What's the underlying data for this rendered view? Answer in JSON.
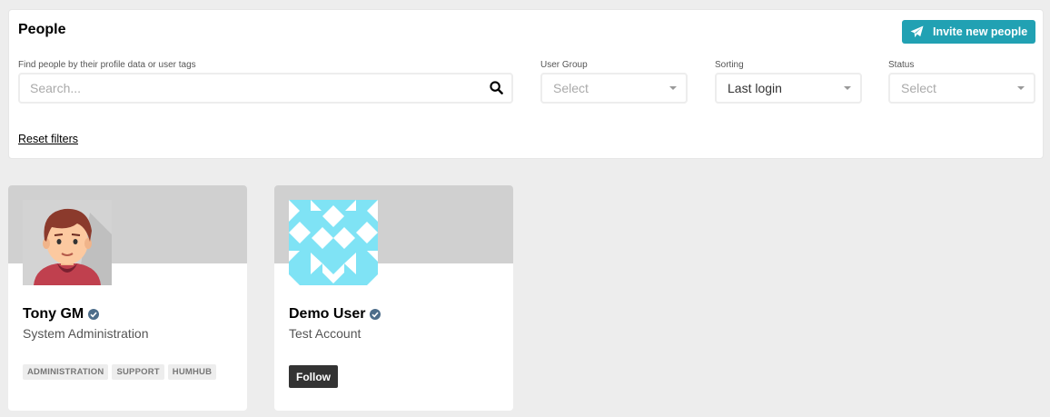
{
  "header": {
    "title": "People",
    "invite_label": "Invite new people"
  },
  "filters": {
    "search_label": "Find people by their profile data or user tags",
    "search_placeholder": "Search...",
    "user_group": {
      "label": "User Group",
      "value": "Select"
    },
    "sorting": {
      "label": "Sorting",
      "value": "Last login"
    },
    "status": {
      "label": "Status",
      "value": "Select"
    },
    "reset_label": "Reset filters"
  },
  "cards": [
    {
      "name": "Tony GM",
      "subtitle": "System Administration",
      "tags": [
        "ADMINISTRATION",
        "SUPPORT",
        "HUMHUB"
      ]
    },
    {
      "name": "Demo User",
      "subtitle": "Test Account",
      "action_label": "Follow"
    }
  ],
  "colors": {
    "accent": "#21a1b3",
    "identicon": "#7fe3f5",
    "verified": "#4d6d8a"
  }
}
